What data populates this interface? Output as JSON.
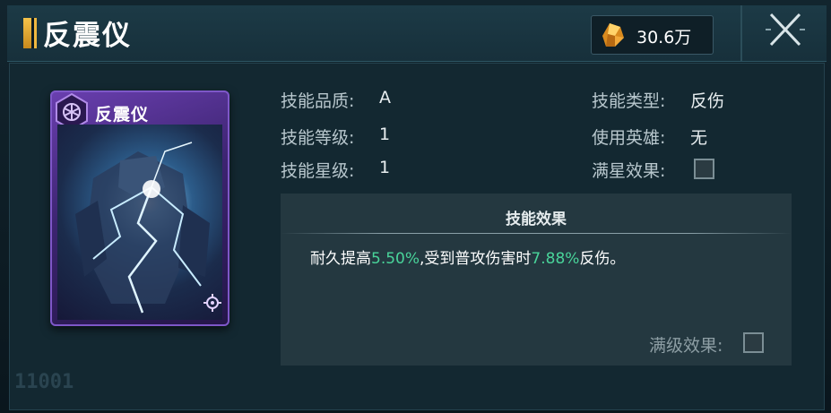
{
  "header": {
    "title": "反震仪",
    "currency_value": "30.6万"
  },
  "card": {
    "title": "反震仪"
  },
  "info": {
    "quality_label": "技能品质:",
    "quality_value": "A",
    "level_label": "技能等级:",
    "level_value": "1",
    "star_label": "技能星级:",
    "star_value": "1",
    "type_label": "技能类型:",
    "type_value": "反伤",
    "hero_label": "使用英雄:",
    "hero_value": "无",
    "full_star_label": "满星效果:"
  },
  "effect": {
    "title": "技能效果",
    "text_part1": "耐久提高",
    "value1": "5.50%",
    "text_part2": ",受到普攻伤害时",
    "value2": "7.88%",
    "text_part3": "反伤。",
    "max_level_label": "满级效果:"
  },
  "corner_code": "11001",
  "colors": {
    "highlight": "#49d49a",
    "title_accent": "#f0b840",
    "card_purple": "#6a3fb0"
  }
}
